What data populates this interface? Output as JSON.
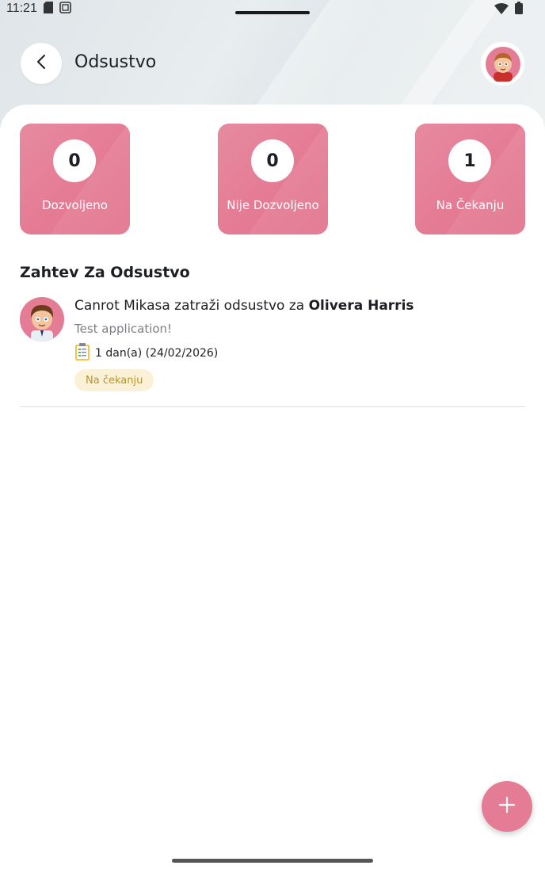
{
  "status_bar": {
    "time": "11:21"
  },
  "header": {
    "title": "Odsustvo"
  },
  "colors": {
    "accent": "#e57c95",
    "pending_bg": "#fbf1d6",
    "pending_text": "#b89528"
  },
  "stats": [
    {
      "value": "0",
      "label": "Dozvoljeno"
    },
    {
      "value": "0",
      "label": "Nije Dozvoljeno"
    },
    {
      "value": "1",
      "label": "Na Čekanju"
    }
  ],
  "section": {
    "title": "Zahtev Za Odsustvo"
  },
  "requests": [
    {
      "text_prefix": "Canrot Mikasa zatraži odsustvo za ",
      "employee": "Olivera Harris",
      "reason": "Test application!",
      "duration": "1 dan(a) (24/02/2026)",
      "status": "Na čekanju"
    }
  ],
  "icons": {
    "back": "chevron-left-icon",
    "profile": "avatar",
    "duration": "clipboard-icon",
    "fab": "plus-icon"
  }
}
